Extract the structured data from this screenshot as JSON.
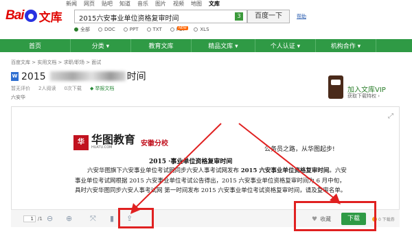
{
  "topnav": [
    "新闻",
    "网页",
    "贴吧",
    "知道",
    "音乐",
    "图片",
    "视频",
    "地图",
    "文库"
  ],
  "topnav_active_index": 8,
  "logo": {
    "text1": "Bai",
    "text2": "文库"
  },
  "search": {
    "value": "2015六安事业单位资格复审时间",
    "badge": "3",
    "button": "百度一下",
    "help": "帮助"
  },
  "filters": [
    {
      "label": "全部",
      "selected": true
    },
    {
      "label": "DOC"
    },
    {
      "label": "PPT"
    },
    {
      "label": "TXT"
    },
    {
      "label": "PDF"
    },
    {
      "label": "XLS"
    }
  ],
  "new_badge": "NEW",
  "nav": [
    {
      "label": "首页"
    },
    {
      "label": "分类 ▾"
    },
    {
      "label": "教育文库"
    },
    {
      "label": "精品文库 ▾"
    },
    {
      "label": "个人认证 ▾"
    },
    {
      "label": "机构合作 ▾"
    }
  ],
  "breadcrumb": "百度文库 > 实用文档 > 求职/职场 > 面试",
  "doc": {
    "type_icon": "W",
    "title": "2015",
    "title_suffix": "时间",
    "rating": "暂无评价",
    "readers": "2人阅读",
    "downloads": "0次下载",
    "report": "举报文档",
    "author": "六安华"
  },
  "vip": {
    "title": "加入文库VIP",
    "subtitle": "获取下载特权 ›"
  },
  "page": {
    "brand_box": "华",
    "brand_name": "华图教育",
    "brand_url": "HUATU.COM",
    "brand_region": "安徽分校",
    "slogan": "公务员之路，从华图起步!",
    "heading": "2015 ·事业单位资格复审时间",
    "body_1": "六安华图旗下六安事业单位考试网同步六安人事考试网发布 ",
    "body_bold_1": "2015 六安事业单位资格复审时间",
    "body_2": "。六安事业单位考试网根据 2015 六安事业单位考试公告得出，2015 六安事业单位资格复审时间为 6 月中旬，具时六安华图同步六安人事考试网 第一时间发布 2015 六安事业单位考试资格复审时间，请及复审名单。"
  },
  "toolbar": {
    "page_current": "1",
    "page_total": "/1",
    "favorite": "收藏",
    "download": "下载",
    "download_cost": "0 下载券"
  },
  "colors": {
    "green": "#2f9a45",
    "highlight": "#e02020",
    "brand_red": "#e10602"
  }
}
